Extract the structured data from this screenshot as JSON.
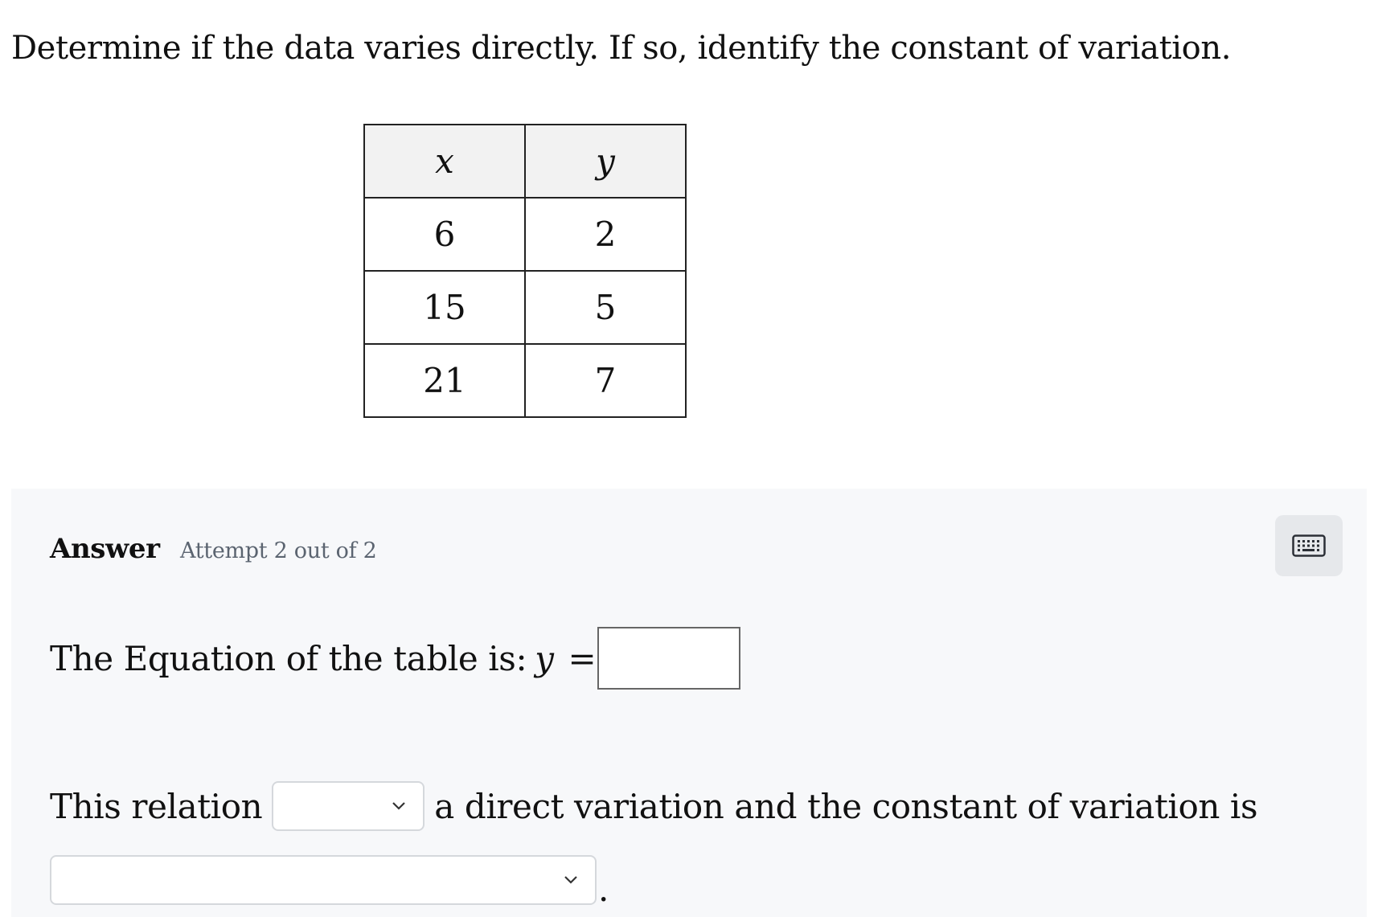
{
  "question": {
    "prompt": "Determine if the data varies directly. If so, identify the constant of variation."
  },
  "table": {
    "headers": [
      "x",
      "y"
    ],
    "rows": [
      [
        "6",
        "2"
      ],
      [
        "15",
        "5"
      ],
      [
        "21",
        "7"
      ]
    ]
  },
  "answer": {
    "label": "Answer",
    "attempt": "Attempt 2 out of 2",
    "keyboard_icon": "keyboard-icon",
    "equation_prefix": "The Equation of the table is:",
    "equation_var": "y",
    "equation_eq": "=",
    "equation_value": "",
    "relation_prefix": "This relation",
    "relation_selected": "",
    "relation_suffix": "a direct variation and the constant of variation is",
    "constant_selected": "",
    "period": "."
  }
}
